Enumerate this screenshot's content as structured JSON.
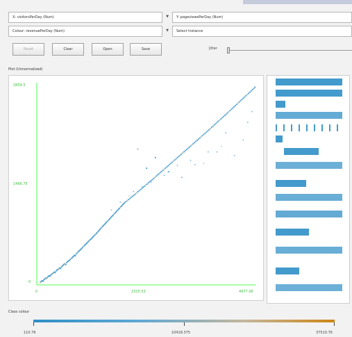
{
  "controls": {
    "x_axis": "X: visitorsPerDay (Num)",
    "y_axis": "Y: pageviewsPerDay (Num)",
    "colour": "Colour: revenuePerDay (Num)",
    "select_instance": "Select Instance",
    "buttons": [
      "Reset",
      "Clear",
      "Open",
      "Save"
    ],
    "jitter_label": "Jitter"
  },
  "plot": {
    "title": "Plot (Unnormalized)",
    "x_ticks": [
      "0",
      "2325.53",
      "4977.06"
    ],
    "y_ticks": [
      "2859.5",
      "1466.75",
      "0"
    ],
    "colors": {
      "axis": "#4dff4d",
      "point": "#2f8fc6",
      "point_alt": "#8aa7a4"
    }
  },
  "legend": {
    "label": "Class colour",
    "values": [
      "110.76",
      "10418.375",
      "37510.76"
    ]
  },
  "chart_data": {
    "type": "scatter",
    "x_label": "visitorsPerDay",
    "y_label": "pageviewsPerDay",
    "xlim": [
      0,
      4977.06
    ],
    "ylim": [
      0,
      2859.5
    ],
    "points": [
      [
        80,
        35
      ],
      [
        100,
        48
      ],
      [
        120,
        61
      ],
      [
        140,
        50
      ],
      [
        160,
        70
      ],
      [
        180,
        82
      ],
      [
        200,
        96
      ],
      [
        220,
        88
      ],
      [
        240,
        104
      ],
      [
        260,
        118
      ],
      [
        280,
        131
      ],
      [
        300,
        122
      ],
      [
        320,
        140
      ],
      [
        340,
        151
      ],
      [
        360,
        162
      ],
      [
        380,
        170
      ],
      [
        400,
        182
      ],
      [
        420,
        173
      ],
      [
        440,
        196
      ],
      [
        460,
        211
      ],
      [
        480,
        218
      ],
      [
        500,
        226
      ],
      [
        520,
        240
      ],
      [
        540,
        232
      ],
      [
        560,
        251
      ],
      [
        580,
        265
      ],
      [
        600,
        279
      ],
      [
        620,
        291
      ],
      [
        640,
        302
      ],
      [
        660,
        286
      ],
      [
        680,
        315
      ],
      [
        700,
        329
      ],
      [
        720,
        338
      ],
      [
        740,
        346
      ],
      [
        760,
        359
      ],
      [
        780,
        371
      ],
      [
        800,
        382
      ],
      [
        820,
        396
      ],
      [
        840,
        405
      ],
      [
        860,
        421
      ],
      [
        880,
        412
      ],
      [
        900,
        440
      ],
      [
        920,
        451
      ],
      [
        940,
        466
      ],
      [
        960,
        478
      ],
      [
        980,
        490
      ],
      [
        1000,
        502
      ],
      [
        1020,
        514
      ],
      [
        1040,
        528
      ],
      [
        1060,
        541
      ],
      [
        1080,
        555
      ],
      [
        1100,
        568
      ],
      [
        1120,
        577
      ],
      [
        1140,
        591
      ],
      [
        1160,
        604
      ],
      [
        1180,
        618
      ],
      [
        1200,
        629
      ],
      [
        1220,
        642
      ],
      [
        1240,
        651
      ],
      [
        1260,
        667
      ],
      [
        1280,
        681
      ],
      [
        1300,
        692
      ],
      [
        1320,
        708
      ],
      [
        1340,
        715
      ],
      [
        1360,
        731
      ],
      [
        1380,
        744
      ],
      [
        1400,
        759
      ],
      [
        1420,
        772
      ],
      [
        1440,
        786
      ],
      [
        1460,
        801
      ],
      [
        1480,
        816
      ],
      [
        1500,
        828
      ],
      [
        1520,
        841
      ],
      [
        1540,
        855
      ],
      [
        1560,
        869
      ],
      [
        1580,
        881
      ],
      [
        1600,
        895
      ],
      [
        1620,
        908
      ],
      [
        1640,
        920
      ],
      [
        1660,
        934
      ],
      [
        1680,
        948
      ],
      [
        1700,
        963
      ],
      [
        1720,
        976
      ],
      [
        1740,
        988
      ],
      [
        1760,
        1002
      ],
      [
        1780,
        1015
      ],
      [
        1800,
        1028
      ],
      [
        1820,
        1042
      ],
      [
        1840,
        1058
      ],
      [
        1860,
        1069
      ],
      [
        1880,
        1083
      ],
      [
        1900,
        1096
      ],
      [
        1920,
        1109
      ],
      [
        1940,
        1123
      ],
      [
        1960,
        1137
      ],
      [
        1980,
        1150
      ],
      [
        2000,
        1164
      ],
      [
        2030,
        1178
      ],
      [
        2060,
        1193
      ],
      [
        2090,
        1207
      ],
      [
        2120,
        1222
      ],
      [
        2150,
        1239
      ],
      [
        2180,
        1253
      ],
      [
        2210,
        1268
      ],
      [
        2240,
        1283
      ],
      [
        2270,
        1300
      ],
      [
        2300,
        1317
      ],
      [
        2330,
        1331
      ],
      [
        2360,
        1348
      ],
      [
        2390,
        1362
      ],
      [
        2420,
        1379
      ],
      [
        2450,
        1394
      ],
      [
        2480,
        1411
      ],
      [
        2510,
        1425
      ],
      [
        2540,
        1443
      ],
      [
        2570,
        1459
      ],
      [
        2600,
        1474
      ],
      [
        2630,
        1489
      ],
      [
        2660,
        1505
      ],
      [
        2690,
        1522
      ],
      [
        2720,
        1539
      ],
      [
        2750,
        1556
      ],
      [
        2780,
        1571
      ],
      [
        2810,
        1588
      ],
      [
        2840,
        1604
      ],
      [
        2870,
        1621
      ],
      [
        2900,
        1637
      ],
      [
        2930,
        1652
      ],
      [
        2960,
        1668
      ],
      [
        2990,
        1685
      ],
      [
        3020,
        1702
      ],
      [
        3050,
        1718
      ],
      [
        3080,
        1734
      ],
      [
        3110,
        1751
      ],
      [
        3140,
        1767
      ],
      [
        3170,
        1783
      ],
      [
        3200,
        1800
      ],
      [
        3230,
        1816
      ],
      [
        3260,
        1832
      ],
      [
        3290,
        1849
      ],
      [
        3320,
        1865
      ],
      [
        3350,
        1881
      ],
      [
        3380,
        1898
      ],
      [
        3410,
        1914
      ],
      [
        3440,
        1930
      ],
      [
        3470,
        1946
      ],
      [
        3500,
        1963
      ],
      [
        3530,
        1980
      ],
      [
        3560,
        1996
      ],
      [
        3590,
        2012
      ],
      [
        3620,
        2029
      ],
      [
        3650,
        2045
      ],
      [
        3680,
        2061
      ],
      [
        3710,
        2078
      ],
      [
        3740,
        2094
      ],
      [
        3770,
        2111
      ],
      [
        3800,
        2128
      ],
      [
        3830,
        2144
      ],
      [
        3860,
        2160
      ],
      [
        3890,
        2177
      ],
      [
        3920,
        2194
      ],
      [
        3950,
        2211
      ],
      [
        3980,
        2228
      ],
      [
        4010,
        2245
      ],
      [
        4040,
        2262
      ],
      [
        4070,
        2279
      ],
      [
        4100,
        2297
      ],
      [
        4130,
        2314
      ],
      [
        4160,
        2330
      ],
      [
        4190,
        2347
      ],
      [
        4220,
        2364
      ],
      [
        4250,
        2381
      ],
      [
        4280,
        2398
      ],
      [
        4310,
        2415
      ],
      [
        4340,
        2432
      ],
      [
        4370,
        2449
      ],
      [
        4400,
        2466
      ],
      [
        4430,
        2484
      ],
      [
        4460,
        2501
      ],
      [
        4490,
        2518
      ],
      [
        4520,
        2536
      ],
      [
        4550,
        2553
      ],
      [
        4580,
        2571
      ],
      [
        4610,
        2588
      ],
      [
        4640,
        2606
      ],
      [
        4670,
        2623
      ],
      [
        4700,
        2640
      ],
      [
        4730,
        2657
      ],
      [
        4760,
        2675
      ],
      [
        4790,
        2692
      ],
      [
        4820,
        2709
      ],
      [
        4850,
        2726
      ],
      [
        4880,
        2744
      ],
      [
        4910,
        2761
      ],
      [
        4940,
        2778
      ],
      [
        4965,
        2796
      ],
      [
        2300,
        1920
      ],
      [
        2500,
        1650
      ],
      [
        2700,
        1800
      ],
      [
        3000,
        1600
      ],
      [
        3300,
        1520
      ],
      [
        3600,
        1700
      ],
      [
        3900,
        1880
      ],
      [
        4200,
        1960
      ],
      [
        4500,
        1830
      ],
      [
        4700,
        2050
      ],
      [
        4800,
        2300
      ],
      [
        4900,
        2450
      ],
      [
        4300,
        2150
      ],
      [
        4100,
        1880
      ],
      [
        3800,
        1720
      ],
      [
        3500,
        1760
      ],
      [
        3200,
        1690
      ],
      [
        2900,
        1550
      ],
      [
        2600,
        1450
      ],
      [
        2400,
        1390
      ],
      [
        2200,
        1320
      ],
      [
        2100,
        1260
      ],
      [
        1900,
        1170
      ],
      [
        1700,
        1060
      ]
    ]
  }
}
